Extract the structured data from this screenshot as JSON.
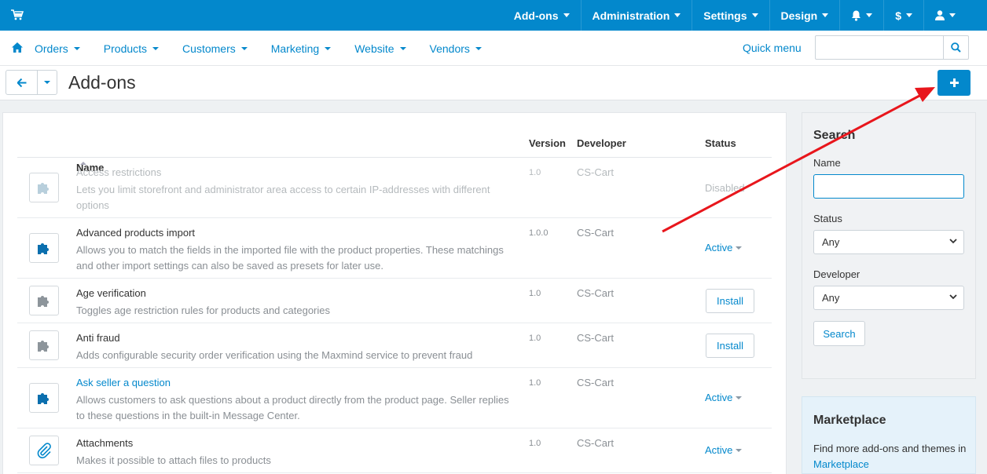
{
  "topbar": {
    "items": [
      {
        "label": "Add-ons"
      },
      {
        "label": "Administration"
      },
      {
        "label": "Settings"
      },
      {
        "label": "Design"
      },
      {
        "label": ""
      },
      {
        "label": "$"
      },
      {
        "label": ""
      }
    ]
  },
  "subnav": {
    "items": [
      {
        "label": "Orders"
      },
      {
        "label": "Products"
      },
      {
        "label": "Customers"
      },
      {
        "label": "Marketing"
      },
      {
        "label": "Website"
      },
      {
        "label": "Vendors"
      }
    ],
    "quick_menu": "Quick menu",
    "search_value": ""
  },
  "page": {
    "title": "Add-ons"
  },
  "table": {
    "headers": {
      "name": "Name",
      "version": "Version",
      "developer": "Developer",
      "status": "Status"
    },
    "rows": [
      {
        "name": "Access restrictions",
        "desc": "Lets you limit storefront and administrator area access to certain IP-addresses with different options",
        "version": "1.0",
        "developer": "CS-Cart",
        "status": "Disabled",
        "icon": "puzzle-gray-icon"
      },
      {
        "name": "Advanced products import",
        "desc": "Allows you to match the fields in the imported file with the product properties. These matchings and other import settings can also be saved as presets for later use.",
        "version": "1.0.0",
        "developer": "CS-Cart",
        "status": "Active",
        "icon": "puzzle-blue-icon"
      },
      {
        "name": "Age verification",
        "desc": "Toggles age restriction rules for products and categories",
        "version": "1.0",
        "developer": "CS-Cart",
        "status": "Install",
        "icon": "puzzle-gray-icon"
      },
      {
        "name": "Anti fraud",
        "desc": "Adds configurable security order verification using the Maxmind service to prevent fraud",
        "version": "1.0",
        "developer": "CS-Cart",
        "status": "Install",
        "icon": "puzzle-gray-icon"
      },
      {
        "name": "Ask seller a question",
        "desc": "Allows customers to ask questions about a product directly from the product page. Seller replies to these questions in the built-in Message Center.",
        "version": "1.0",
        "developer": "CS-Cart",
        "status": "Active",
        "icon": "puzzle-blue-icon"
      },
      {
        "name": "Attachments",
        "desc": "Makes it possible to attach files to products",
        "version": "1.0",
        "developer": "CS-Cart",
        "status": "Active",
        "icon": "paperclip-icon"
      }
    ]
  },
  "sidebar": {
    "title": "Search",
    "name_label": "Name",
    "name_value": "",
    "status_label": "Status",
    "status_value": "Any",
    "developer_label": "Developer",
    "developer_value": "Any",
    "search_button": "Search"
  },
  "marketplace": {
    "title": "Marketplace",
    "text": "Find more add-ons and themes in ",
    "link": "Marketplace"
  },
  "colors": {
    "primary": "#0388cc",
    "annotation": "#e8161c"
  }
}
